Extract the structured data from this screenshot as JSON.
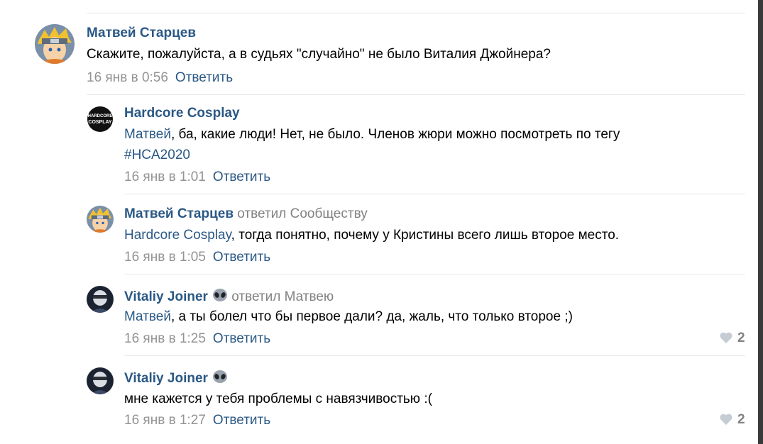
{
  "comments": [
    {
      "author": "Матвей Старцев",
      "reply_note": "",
      "text_parts": [
        "Скажите, пожалуйста, а в судьях \"случайно\" не было Виталия Джойнера?"
      ],
      "date": "16 янв в 0:56",
      "reply_label": "Ответить",
      "likes": ""
    },
    {
      "author": "Hardcore Cosplay",
      "reply_note": "",
      "mention": "Матвей",
      "text_line1": ", ба, какие люди! Нет, не было. Членов жюри можно посмотреть по тегу",
      "hashtag": "#HCA2020",
      "avatar_text_top": "HARDCORE",
      "avatar_text_bottom": "COSPLAY",
      "date": "16 янв в 1:01",
      "reply_label": "Ответить",
      "likes": ""
    },
    {
      "author": "Матвей Старцев",
      "reply_note": "ответил Сообществу",
      "mention": "Hardcore Cosplay",
      "text_rest": ", тогда понятно, почему у Кристины всего лишь второе место.",
      "date": "16 янв в 1:05",
      "reply_label": "Ответить",
      "likes": ""
    },
    {
      "author": "Vitaliy Joiner",
      "emoji": "alien-icon",
      "reply_note": "ответил Матвею",
      "mention": "Матвей",
      "text_rest": ", а ты болел что бы первое дали? да, жаль, что только второе ;)",
      "date": "16 янв в 1:25",
      "reply_label": "Ответить",
      "likes": "2"
    },
    {
      "author": "Vitaliy Joiner",
      "emoji": "alien-icon",
      "reply_note": "",
      "text_plain": "мне кажется у тебя проблемы с навязчивостью :(",
      "date": "16 янв в 1:27",
      "reply_label": "Ответить",
      "likes": "2"
    }
  ],
  "colors": {
    "link": "#2a5885",
    "meta": "#939393",
    "divider": "#e7e8ec"
  }
}
